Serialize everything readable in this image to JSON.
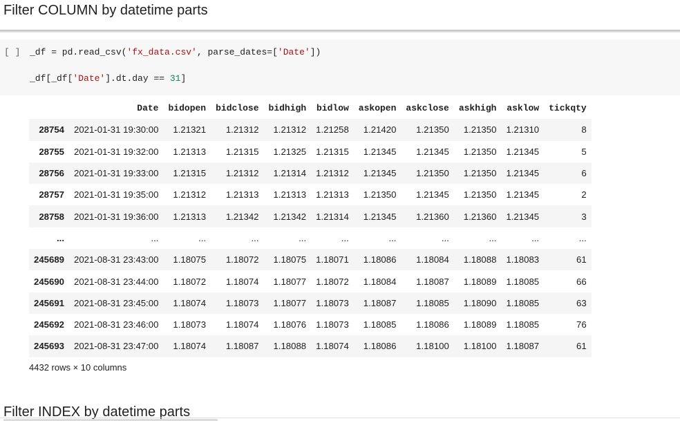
{
  "sections": {
    "heading_1": "Filter COLUMN by datetime parts",
    "heading_2": "Filter INDEX by datetime parts"
  },
  "cell": {
    "run_label": "[ ]",
    "line1": {
      "a": "_df = pd.read_csv(",
      "b": "'fx_data.csv'",
      "c": ", parse_dates=[",
      "d": "'Date'",
      "e": "])"
    },
    "line2": {
      "a": "_df[_df[",
      "b": "'Date'",
      "c": "].dt.day == ",
      "d": "31",
      "e": "]"
    }
  },
  "table": {
    "columns": [
      "",
      "Date",
      "bidopen",
      "bidclose",
      "bidhigh",
      "bidlow",
      "askopen",
      "askclose",
      "askhigh",
      "asklow",
      "tickqty"
    ],
    "rows": [
      [
        "28754",
        "2021-01-31 19:30:00",
        "1.21321",
        "1.21312",
        "1.21312",
        "1.21258",
        "1.21420",
        "1.21350",
        "1.21350",
        "1.21310",
        "8"
      ],
      [
        "28755",
        "2021-01-31 19:32:00",
        "1.21313",
        "1.21315",
        "1.21325",
        "1.21315",
        "1.21345",
        "1.21345",
        "1.21350",
        "1.21345",
        "5"
      ],
      [
        "28756",
        "2021-01-31 19:33:00",
        "1.21315",
        "1.21312",
        "1.21314",
        "1.21312",
        "1.21345",
        "1.21350",
        "1.21350",
        "1.21345",
        "6"
      ],
      [
        "28757",
        "2021-01-31 19:35:00",
        "1.21312",
        "1.21313",
        "1.21313",
        "1.21313",
        "1.21350",
        "1.21345",
        "1.21350",
        "1.21345",
        "2"
      ],
      [
        "28758",
        "2021-01-31 19:36:00",
        "1.21313",
        "1.21342",
        "1.21342",
        "1.21314",
        "1.21345",
        "1.21360",
        "1.21360",
        "1.21345",
        "3"
      ],
      [
        "...",
        "...",
        "...",
        "...",
        "...",
        "...",
        "...",
        "...",
        "...",
        "...",
        "..."
      ],
      [
        "245689",
        "2021-08-31 23:43:00",
        "1.18075",
        "1.18072",
        "1.18075",
        "1.18071",
        "1.18086",
        "1.18084",
        "1.18088",
        "1.18083",
        "61"
      ],
      [
        "245690",
        "2021-08-31 23:44:00",
        "1.18072",
        "1.18074",
        "1.18077",
        "1.18072",
        "1.18084",
        "1.18087",
        "1.18089",
        "1.18085",
        "66"
      ],
      [
        "245691",
        "2021-08-31 23:45:00",
        "1.18074",
        "1.18073",
        "1.18077",
        "1.18073",
        "1.18087",
        "1.18085",
        "1.18090",
        "1.18085",
        "63"
      ],
      [
        "245692",
        "2021-08-31 23:46:00",
        "1.18073",
        "1.18074",
        "1.18076",
        "1.18073",
        "1.18085",
        "1.18086",
        "1.18089",
        "1.18085",
        "76"
      ],
      [
        "245693",
        "2021-08-31 23:47:00",
        "1.18074",
        "1.18087",
        "1.18088",
        "1.18074",
        "1.18086",
        "1.18100",
        "1.18100",
        "1.18087",
        "61"
      ]
    ],
    "summary": "4432 rows × 10 columns"
  },
  "colors": {
    "string": "#a31515",
    "number": "#098658",
    "cell_background": "#f7f7f7",
    "row_stripe": "#f5f5f5"
  }
}
